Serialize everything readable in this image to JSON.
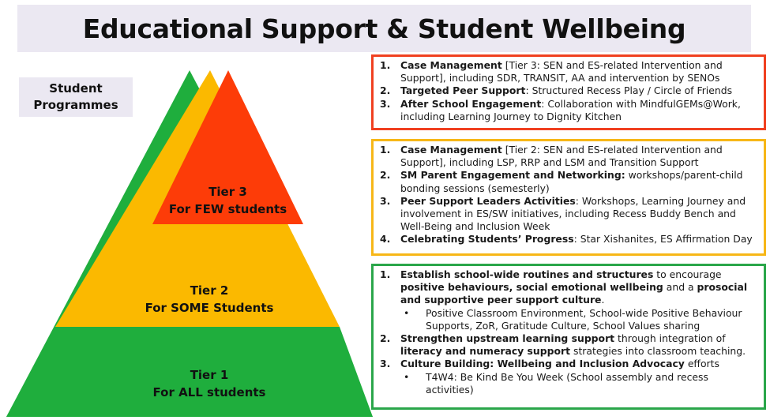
{
  "title": "Educational Support & Student Wellbeing",
  "side_label": "Student\nProgrammes",
  "colors": {
    "tier1": "#1fae3d",
    "tier2": "#fbb900",
    "tier3": "#fd3c08",
    "tier3_border": "#f04020",
    "tier2_border": "#f7b717",
    "tier1_border": "#2aa64a",
    "title_band": "#ebe8f2"
  },
  "pyramid": {
    "tier3": {
      "line1": "Tier 3",
      "line2": "For FEW students"
    },
    "tier2": {
      "line1": "Tier 2",
      "line2": "For SOME Students"
    },
    "tier1": {
      "line1": "Tier 1",
      "line2": "For ALL students"
    }
  },
  "tier3_box": {
    "items": [
      {
        "num": "1.",
        "bold": "Case Management",
        "rest": " [Tier 3: SEN and ES-related Intervention and Support], including SDR, TRANSIT, AA and intervention by SENOs"
      },
      {
        "num": "2.",
        "bold": "Targeted Peer Support",
        "rest": ": Structured Recess Play / Circle of Friends"
      },
      {
        "num": "3.",
        "bold": "After School Engagement",
        "rest": ": Collaboration with MindfulGEMs@Work, including Learning Journey to Dignity Kitchen"
      }
    ]
  },
  "tier2_box": {
    "items": [
      {
        "num": "1.",
        "bold": "Case Management",
        "rest": " [Tier 2: SEN and ES-related Intervention and Support], including LSP, RRP and LSM and Transition Support"
      },
      {
        "num": "2.",
        "bold": "SM Parent Engagement and Networking:",
        "rest": " workshops/parent-child bonding sessions (semesterly)"
      },
      {
        "num": "3.",
        "bold": "Peer Support Leaders Activities",
        "rest": ": Workshops, Learning Journey and involvement in ES/SW initiatives, including Recess Buddy Bench and Well-Being and Inclusion Week"
      },
      {
        "num": "4.",
        "bold": "Celebrating Students’ Progress",
        "rest": ": Star Xishanites, ES Affirmation Day"
      }
    ]
  },
  "tier1_box": {
    "item1": {
      "num": "1.",
      "b1": "Establish school-wide routines and structures",
      "t1": " to encourage ",
      "b2": "positive behaviours, social emotional wellbeing",
      "t2": " and a ",
      "b3": "prosocial and supportive peer support culture",
      "t3": ".",
      "bullet": "•",
      "sub": "Positive Classroom Environment, School-wide Positive Behaviour Supports, ZoR, Gratitude Culture, School Values sharing"
    },
    "item2": {
      "num": "2.",
      "b1": "Strengthen upstream learning support",
      "t1": " through integration of ",
      "b2": "literacy and numeracy support",
      "t2": " strategies into classroom teaching."
    },
    "item3": {
      "num": "3.",
      "b1": "Culture Building: Wellbeing and Inclusion Advocacy",
      "t1": " efforts",
      "bullet": "•",
      "sub": "T4W4: Be Kind Be You Week (School assembly and recess activities)"
    }
  }
}
